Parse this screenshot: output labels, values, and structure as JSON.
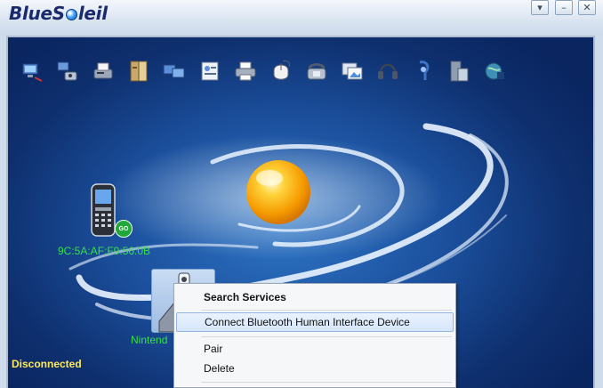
{
  "app": {
    "logo_text_before": "BlueS",
    "logo_text_after": "leil"
  },
  "window_buttons": [
    {
      "name": "menu-dropdown-button",
      "glyph": "▾"
    },
    {
      "name": "minimize-button",
      "glyph": "–"
    },
    {
      "name": "close-button",
      "glyph": "✕"
    }
  ],
  "toolbar": {
    "services": [
      "network-icon",
      "dialup-icon",
      "fax-icon",
      "file-transfer-icon",
      "lan-access-icon",
      "personal-area-network-icon",
      "printer-icon",
      "hid-mouse-icon",
      "telephony-icon",
      "image-transfer-icon",
      "headset-icon",
      "audio-gateway-icon",
      "sync-icon",
      "bluetooth-globe-icon"
    ]
  },
  "devices": {
    "phone": {
      "label": "9C:5A:AF:F9:56:0B",
      "icon": "mobile-phone-icon",
      "badge": "GO"
    },
    "nintendo": {
      "label": "Nintend",
      "icon": "game-controller-icon"
    }
  },
  "status": {
    "text": "Disconnected"
  },
  "context_menu": {
    "items": [
      {
        "label": "Search Services",
        "bold": true
      },
      {
        "label": "Connect Bluetooth Human Interface Device",
        "highlighted": true
      },
      {
        "label": "Pair"
      },
      {
        "label": "Delete"
      }
    ]
  },
  "colors": {
    "panel_bg": "#1b4f9c",
    "device_label": "#35e04a",
    "status_text": "#ffe85a",
    "menu_highlight": "#d6e6fb"
  }
}
